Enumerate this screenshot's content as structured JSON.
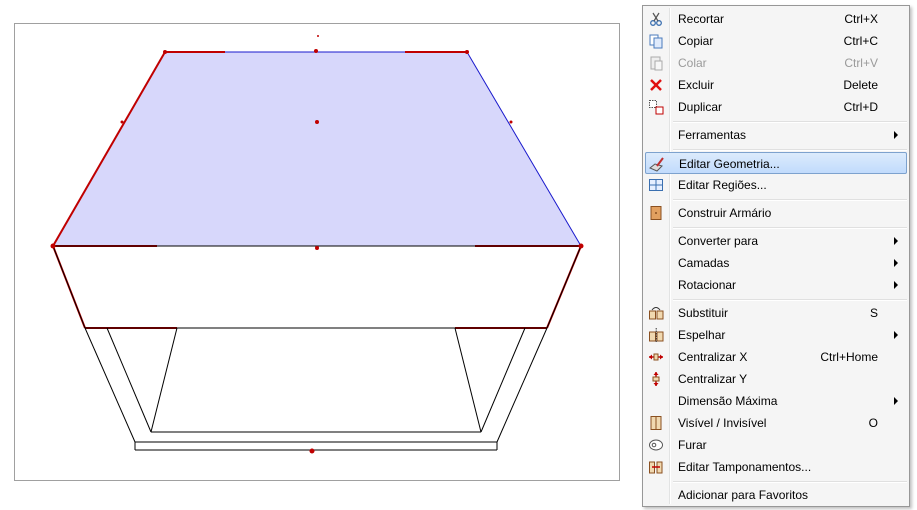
{
  "context_menu": {
    "items": [
      {
        "label": "Recortar",
        "shortcut": "Ctrl+X",
        "icon": "scissors-icon"
      },
      {
        "label": "Copiar",
        "shortcut": "Ctrl+C",
        "icon": "copy-icon"
      },
      {
        "label": "Colar",
        "shortcut": "Ctrl+V",
        "icon": "paste-icon",
        "disabled": true
      },
      {
        "label": "Excluir",
        "shortcut": "Delete",
        "icon": "delete-x-icon"
      },
      {
        "label": "Duplicar",
        "shortcut": "Ctrl+D",
        "icon": "duplicate-icon"
      },
      {
        "label": "Ferramentas",
        "submenu": true
      },
      {
        "label": "Editar Geometria...",
        "icon": "edit-geometry-icon",
        "highlighted": true
      },
      {
        "label": "Editar Regiões...",
        "icon": "edit-regions-icon"
      },
      {
        "label": "Construir Armário",
        "icon": "cabinet-icon"
      },
      {
        "label": "Converter para",
        "submenu": true
      },
      {
        "label": "Camadas",
        "submenu": true
      },
      {
        "label": "Rotacionar",
        "submenu": true
      },
      {
        "label": "Substituir",
        "shortcut": "S",
        "icon": "replace-icon"
      },
      {
        "label": "Espelhar",
        "submenu": true,
        "icon": "mirror-icon"
      },
      {
        "label": "Centralizar X",
        "shortcut": "Ctrl+Home",
        "icon": "center-x-icon"
      },
      {
        "label": "Centralizar Y",
        "icon": "center-y-icon"
      },
      {
        "label": "Dimensão Máxima",
        "submenu": true
      },
      {
        "label": "Visível / Invisível",
        "shortcut": "O",
        "icon": "visibility-icon"
      },
      {
        "label": "Furar",
        "icon": "drill-icon"
      },
      {
        "label": "Editar Tamponamentos...",
        "icon": "edit-panels-icon"
      },
      {
        "label": "Adicionar para Favoritos"
      }
    ]
  },
  "colors": {
    "selection_fill": "#d6d6ff",
    "selection_stroke": "#0000cc",
    "handle_red": "#cc0000",
    "menu_highlight": "#c1dbfc"
  }
}
